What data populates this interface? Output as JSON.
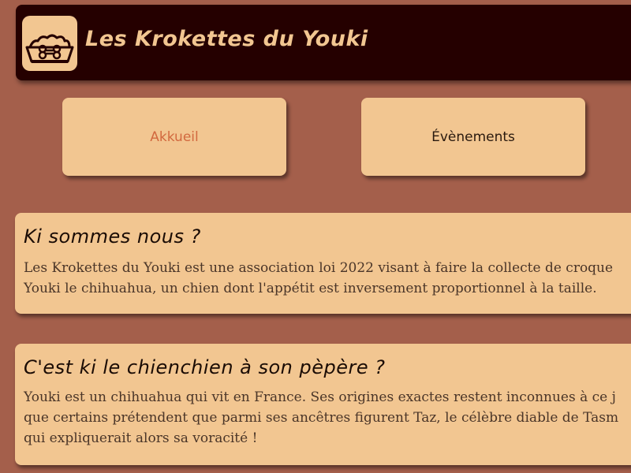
{
  "header": {
    "title": "Les Krokettes du Youki",
    "logo_icon": "dog-bowl-bone-icon"
  },
  "nav": {
    "items": [
      {
        "label": "Akkueil",
        "active": true
      },
      {
        "label": "Évènements",
        "active": false
      }
    ]
  },
  "sections": [
    {
      "title": "Ki sommes nous ?",
      "lines": [
        "Les Krokettes du Youki est une association loi 2022 visant à faire la collecte de croque",
        "Youki le chihuahua, un chien dont l'appétit est inversement proportionnel à la taille."
      ]
    },
    {
      "title": "C'est ki le chienchien à son pèpère ?",
      "lines": [
        "Youki est un chihuahua qui vit en France. Ses origines exactes restent inconnues à ce j",
        "que certains prétendent que parmi ses ancêtres figurent Taz, le célèbre diable de Tasm",
        "qui expliquerait alors sa voracité !"
      ]
    }
  ],
  "colors": {
    "background": "#a45f4b",
    "header_bg": "#250000",
    "card_bg": "#f2c691",
    "active_link": "#d2693f"
  }
}
